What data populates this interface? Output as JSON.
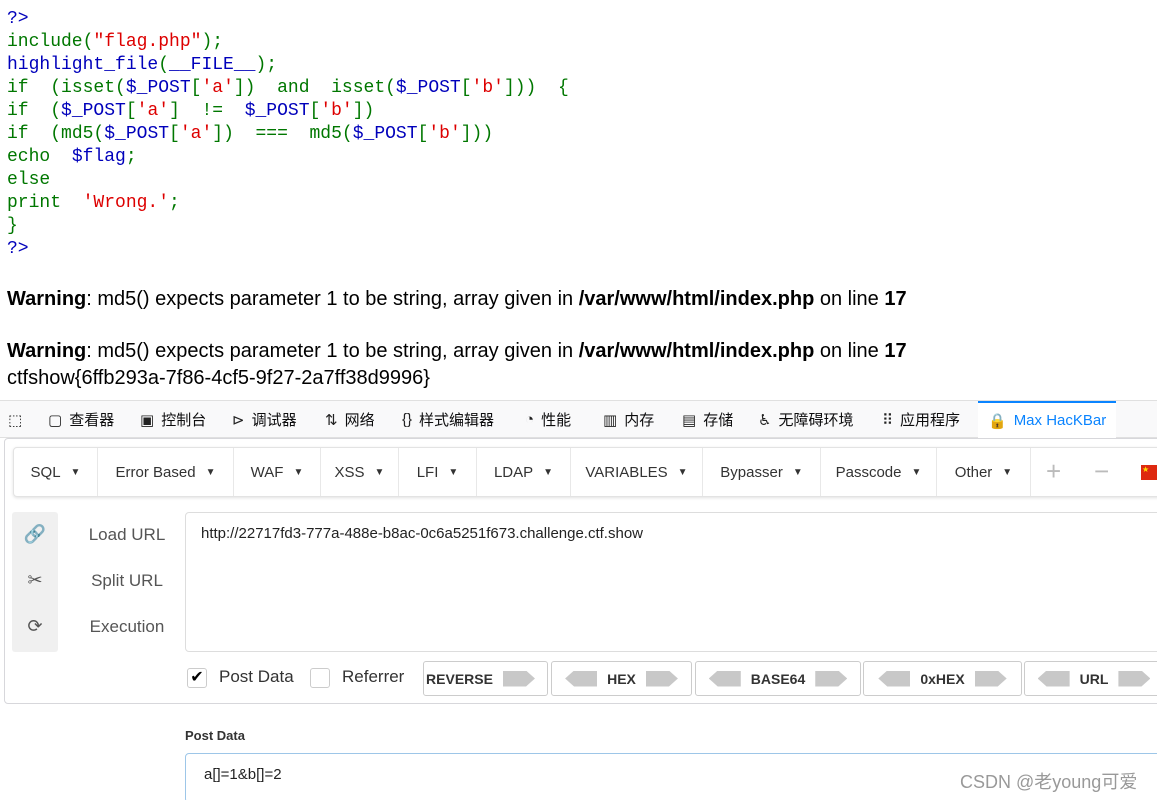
{
  "code": {
    "line0": "?>",
    "line1": {
      "fn": "include",
      "p1": "(",
      "s": "\"flag.php\"",
      "p2": ");"
    },
    "line2": {
      "fn": "highlight_file",
      "p1": "(",
      "c": "__FILE__",
      "p2": ");"
    },
    "line3": {
      "kw": "if",
      "a": "(isset(",
      "v1": "$_POST",
      "k1": "'a'",
      "b": "])",
      "and": "and",
      "c": "isset(",
      "v2": "$_POST",
      "k2": "'b'",
      "d": "]))",
      "e": "{"
    },
    "line4": {
      "kw": "if",
      "a": "(",
      "v1": "$_POST",
      "k1": "'a'",
      "b": "]",
      "op": "!=",
      "v2": "$_POST",
      "k2": "'b'",
      "c": "])"
    },
    "line5": {
      "kw": "if",
      "a": "(md5(",
      "v1": "$_POST",
      "k1": "'a'",
      "b": "])",
      "op": "===",
      "c": "md5(",
      "v2": "$_POST",
      "k2": "'b'",
      "d": "]))"
    },
    "line6": {
      "kw": "echo",
      "v": "$flag",
      ";": ";"
    },
    "line7": "else",
    "line8": {
      "kw": "print",
      "s": "'Wrong.'",
      ";": ";"
    },
    "line9": "}",
    "line10": "?>"
  },
  "warnings": [
    {
      "label": "Warning",
      "msg": ": md5() expects parameter 1 to be string, array given in ",
      "path": "/var/www/html/index.php",
      "on": " on line ",
      "line": "17"
    },
    {
      "label": "Warning",
      "msg": ": md5() expects parameter 1 to be string, array given in ",
      "path": "/var/www/html/index.php",
      "on": " on line ",
      "line": "17"
    }
  ],
  "flag": "ctfshow{6ffb293a-7f86-4cf5-9f27-2a7ff38d9996}",
  "devtools": {
    "tabs": [
      "查看器",
      "控制台",
      "调试器",
      "网络",
      "样式编辑器",
      "性能",
      "内存",
      "存储",
      "无障碍环境",
      "应用程序",
      "Max HacKBar"
    ],
    "active_tab": "Max HacKBar"
  },
  "hackbar": {
    "menu": [
      "SQL",
      "Error Based",
      "WAF",
      "XSS",
      "LFI",
      "LDAP",
      "VARIABLES",
      "Bypasser",
      "Passcode",
      "Other"
    ],
    "plus": "+",
    "minus": "−",
    "actions": [
      "Load URL",
      "Split URL",
      "Execution"
    ],
    "url": "http://22717fd3-777a-488e-b8ac-0c6a5251f673.challenge.ctf.show",
    "post_data_checked": true,
    "post_data_label": "Post Data",
    "referrer_checked": false,
    "referrer_label": "Referrer",
    "encoders": [
      "REVERSE",
      "HEX",
      "BASE64",
      "0xHEX",
      "URL"
    ],
    "post_section_label": "Post Data",
    "post_body": "a[]=1&b[]=2"
  },
  "watermark": "CSDN @老young可爱",
  "colors": {
    "keyword": "#007700",
    "variable": "#0000bb",
    "string": "#dd0000",
    "accent": "#0a84ff"
  }
}
